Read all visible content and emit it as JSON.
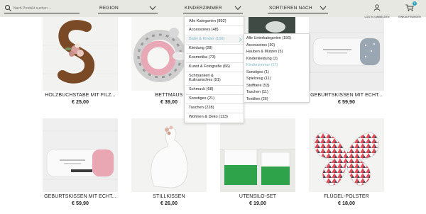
{
  "colors": {
    "topbar": "#e8e8e3",
    "accent": "#7fb7c9",
    "text": "#222222",
    "cart_badge": "#2aa4b6"
  },
  "header": {
    "search_placeholder": "Nach Produkt suchen ...",
    "region_label": "REGION",
    "category_label": "KINDERZIMMER",
    "sort_label": "SORTIEREN NACH",
    "login_label": "LOG IN / ANMELDEN",
    "cart_label": "EINKAUFSWAGEN",
    "cart_count": "0",
    "icons": {
      "search": "search-icon",
      "login": "user-icon",
      "cart": "cart-icon",
      "chevron": "chevron-down-icon"
    }
  },
  "category_menu": {
    "items": [
      {
        "label": "Alle Kategorien (892)",
        "selected": false
      },
      {
        "label": "Accessoires (48)",
        "selected": false
      },
      {
        "label": "Baby & Kinder (156)",
        "selected": true
      },
      {
        "label": "Kleidung (28)",
        "selected": false
      },
      {
        "label": "Kosmetika (73)",
        "selected": false
      },
      {
        "label": "Kunst & Fotografie (66)",
        "selected": false
      },
      {
        "label": "Schmankerl & Kulinarisches (91)",
        "selected": false
      },
      {
        "label": "Schmuck (68)",
        "selected": false
      },
      {
        "label": "Sonstiges (21)",
        "selected": false
      },
      {
        "label": "Taschen (228)",
        "selected": false
      },
      {
        "label": "Wohnen & Deko (113)",
        "selected": false
      }
    ],
    "submenu_arrow": "chevron-right-icon"
  },
  "sub_menu": {
    "items": [
      {
        "label": "Alle Unterkategorien (156)",
        "selected": false
      },
      {
        "label": "Accessoires (30)",
        "selected": false
      },
      {
        "label": "Hauben & Mützen (5)",
        "selected": false
      },
      {
        "label": "Kinderkleidung (2)",
        "selected": false
      },
      {
        "label": "Kinderzimmer (17)",
        "selected": true
      },
      {
        "label": "Sonstiges (1)",
        "selected": false
      },
      {
        "label": "Spielzeug (11)",
        "selected": false
      },
      {
        "label": "Stofftiere (53)",
        "selected": false
      },
      {
        "label": "Taschen (11)",
        "selected": false
      },
      {
        "label": "Textilien (26)",
        "selected": false
      }
    ]
  },
  "products": [
    {
      "name": "HOLZBUCHSTABE MIT FILZ...",
      "price": "€ 25,00"
    },
    {
      "name": "BETTMAUS",
      "price": "€ 39,00"
    },
    {
      "name": "",
      "price": ""
    },
    {
      "name": "",
      "price": ""
    },
    {
      "name": "GEBURTSKISSEN MIT ECHT...",
      "price": "€ 59,90"
    },
    {
      "name": "GEBURTSKISSEN MIT ECHT...",
      "price": "€ 59,90"
    },
    {
      "name": "STILLKISSEN",
      "price": "€ 26,00"
    },
    {
      "name": "UTENSILO-SET",
      "price": "€ 19,00"
    },
    {
      "name": "FLÜGEL-POLSTER",
      "price": "€ 18,00"
    }
  ]
}
